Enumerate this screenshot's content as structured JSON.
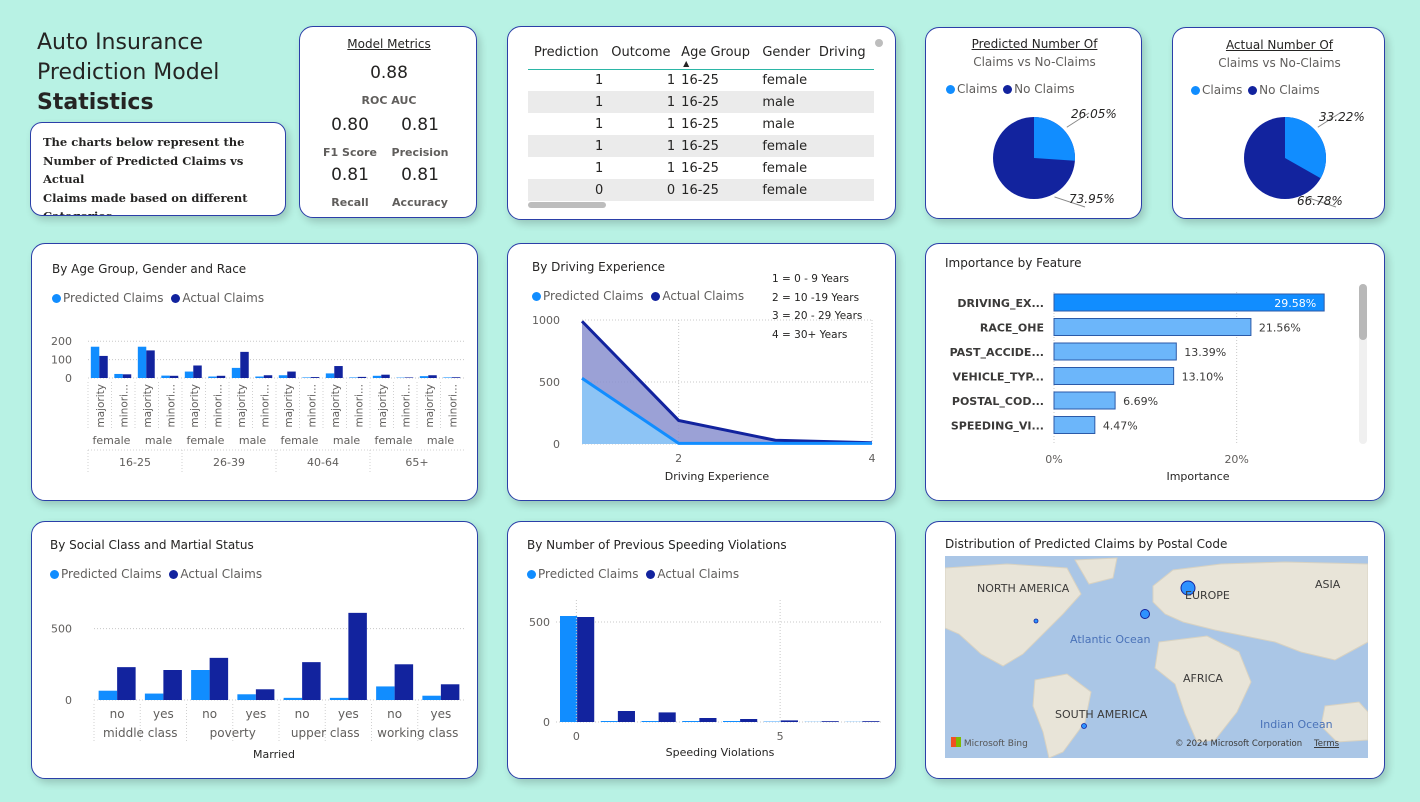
{
  "colors": {
    "predicted": "#118dff",
    "actual": "#12239e",
    "background": "#b8f2e4",
    "border": "#2b3fa8"
  },
  "header": {
    "title_line1": "Auto Insurance",
    "title_line2": "Prediction Model",
    "title_line3": "Statistics"
  },
  "intro": {
    "text_l1": "The charts below represent the",
    "text_l2": "Number of Predicted Claims vs Actual",
    "text_l3": "Claims made based on different",
    "text_l4": "Categories"
  },
  "metrics": {
    "title": "Model Metrics",
    "roc_auc": {
      "value": "0.88",
      "label": "ROC AUC"
    },
    "f1": {
      "value": "0.80",
      "label": "F1 Score"
    },
    "precision": {
      "value": "0.81",
      "label": "Precision"
    },
    "recall": {
      "value": "0.81",
      "label": "Recall"
    },
    "accuracy": {
      "value": "0.81",
      "label": "Accuracy"
    }
  },
  "table": {
    "columns": [
      "Prediction",
      "Outcome",
      "Age Group",
      "Gender",
      "Driving"
    ],
    "rows": [
      [
        "1",
        "1",
        "16-25",
        "female"
      ],
      [
        "1",
        "1",
        "16-25",
        "male"
      ],
      [
        "1",
        "1",
        "16-25",
        "male"
      ],
      [
        "1",
        "1",
        "16-25",
        "female"
      ],
      [
        "1",
        "1",
        "16-25",
        "female"
      ],
      [
        "0",
        "0",
        "16-25",
        "female"
      ]
    ]
  },
  "pie_predicted": {
    "title": "Predicted Number Of",
    "subtitle": "Claims vs No-Claims",
    "legend_claims": "Claims",
    "legend_noclaims": "No Claims",
    "claims_pct": 26.05,
    "claims_label": "26.05%",
    "noclaims_label": "73.95%"
  },
  "pie_actual": {
    "title": "Actual Number Of",
    "subtitle": "Claims vs No-Claims",
    "legend_claims": "Claims",
    "legend_noclaims": "No Claims",
    "claims_pct": 33.22,
    "claims_label": "33.22%",
    "noclaims_label": "66.78%"
  },
  "legend": {
    "predicted": "Predicted Claims",
    "actual": "Actual Claims"
  },
  "chart_data": [
    {
      "id": "age",
      "type": "bar",
      "title": "By Age Group, Gender and Race",
      "ylim": [
        0,
        250
      ],
      "yticks": [
        "0",
        "100",
        "200"
      ],
      "races": [
        "majority",
        "minori..."
      ],
      "genders": [
        "female",
        "male"
      ],
      "age_groups": [
        "16-25",
        "26-39",
        "40-64",
        "65+"
      ],
      "series": [
        {
          "name": "Predicted Claims",
          "values": [
            170,
            22,
            170,
            13,
            35,
            8,
            55,
            8,
            15,
            3,
            25,
            3,
            12,
            2,
            10,
            3
          ]
        },
        {
          "name": "Actual Claims",
          "values": [
            120,
            20,
            150,
            12,
            68,
            12,
            142,
            15,
            35,
            5,
            65,
            6,
            18,
            3,
            15,
            4
          ]
        }
      ]
    },
    {
      "id": "drive",
      "type": "area",
      "title": "By Driving Experience",
      "xlabel": "Driving Experience",
      "x": [
        1,
        2,
        3,
        4
      ],
      "xticks": [
        "2",
        "4"
      ],
      "yticks": [
        "0",
        "500",
        "1000"
      ],
      "ylim": [
        0,
        1000
      ],
      "notes": [
        "1 = 0 - 9 Years",
        "2 = 10 -19 Years",
        "3 = 20 - 29 Years",
        "4 = 30+ Years"
      ],
      "series": [
        {
          "name": "Predicted Claims",
          "values": [
            530,
            5,
            5,
            5
          ]
        },
        {
          "name": "Actual Claims",
          "values": [
            990,
            190,
            30,
            10
          ]
        }
      ]
    },
    {
      "id": "feature",
      "type": "bar",
      "title": "Importance by Feature",
      "xlabel": "Importance",
      "xticks": [
        "0%",
        "20%"
      ],
      "xlim": [
        0,
        30
      ],
      "categories": [
        "DRIVING_EX...",
        "RACE_OHE",
        "PAST_ACCIDE...",
        "VEHICLE_TYP...",
        "POSTAL_COD...",
        "SPEEDING_VI..."
      ],
      "values": [
        29.58,
        21.56,
        13.39,
        13.1,
        6.69,
        4.47
      ],
      "labels": [
        "29.58%",
        "21.56%",
        "13.39%",
        "13.10%",
        "6.69%",
        "4.47%"
      ]
    },
    {
      "id": "social",
      "type": "bar",
      "title": "By Social Class and Martial Status",
      "xlabel": "Married",
      "ylim": [
        0,
        700
      ],
      "yticks": [
        "0",
        "500"
      ],
      "married": [
        "no",
        "yes"
      ],
      "classes": [
        "middle class",
        "poverty",
        "upper class",
        "working class"
      ],
      "series": [
        {
          "name": "Predicted Claims",
          "values": [
            65,
            45,
            210,
            40,
            15,
            15,
            95,
            30
          ]
        },
        {
          "name": "Actual Claims",
          "values": [
            230,
            210,
            295,
            75,
            265,
            610,
            250,
            110
          ]
        }
      ]
    },
    {
      "id": "speed",
      "type": "bar",
      "title": "By Number of Previous Speeding Violations",
      "xlabel": "Speeding Violations",
      "xticks": [
        "0",
        "5"
      ],
      "yticks": [
        "0",
        "500"
      ],
      "ylim": [
        0,
        600
      ],
      "x": [
        0,
        1,
        2,
        3,
        4,
        5,
        6,
        7
      ],
      "series": [
        {
          "name": "Predicted Claims",
          "values": [
            530,
            5,
            5,
            5,
            5,
            2,
            1,
            1
          ]
        },
        {
          "name": "Actual Claims",
          "values": [
            525,
            55,
            48,
            20,
            15,
            8,
            4,
            4
          ]
        }
      ]
    }
  ],
  "map": {
    "title": "Distribution of Predicted Claims by Postal Code",
    "labels": [
      "NORTH AMERICA",
      "EUROPE",
      "ASIA",
      "AFRICA",
      "SOUTH AMERICA",
      "Atlantic Ocean",
      "Indian Ocean"
    ],
    "brand": "Microsoft Bing",
    "copyright": "© 2024 Microsoft Corporation",
    "terms": "Terms"
  }
}
